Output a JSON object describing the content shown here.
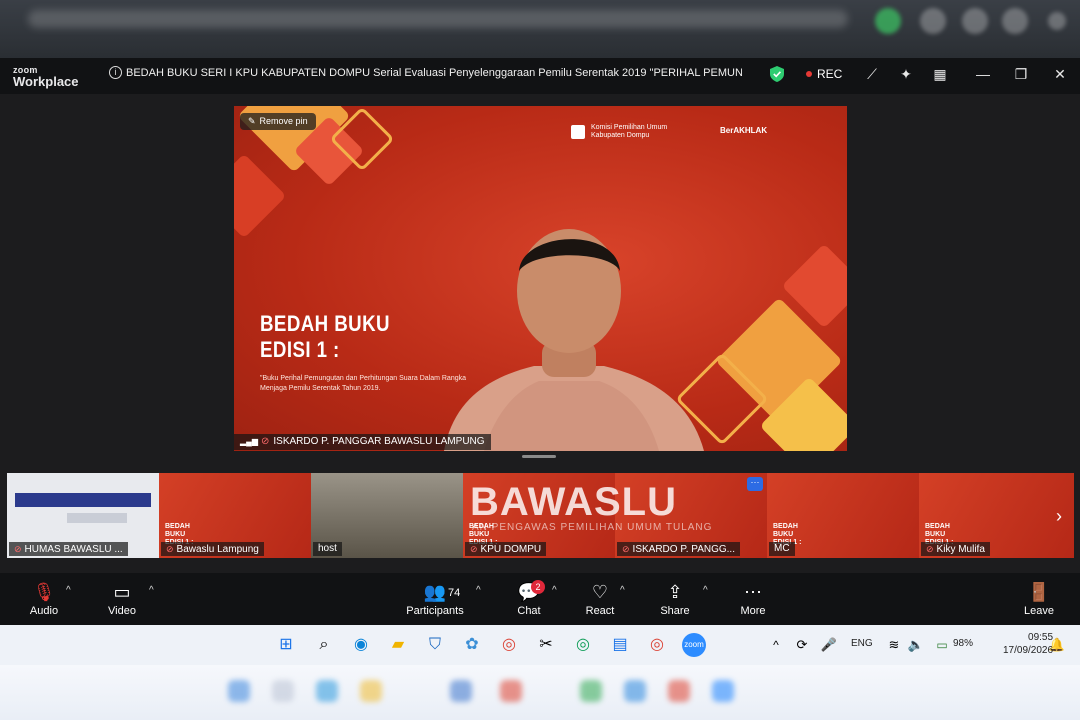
{
  "title_bar": {
    "brand_top": "zoom",
    "brand_bottom": "Workplace",
    "meeting_title": "BEDAH BUKU SERI I KPU KABUPATEN DOMPU Serial Evaluasi Penyelenggaraan Pemilu Serentak 2019 \"PERIHAL PEMUNGUTAN DAN PENGI",
    "rec_label": "REC"
  },
  "pinned": {
    "remove_pin_label": "Remove pin",
    "speaker_name": "ISKARDO P. PANGGAR BAWASLU LAMPUNG",
    "slide_title_line1": "BEDAH BUKU",
    "slide_title_line2": "EDISI 1 :",
    "slide_subtitle": "\"Buku Perihal Pemungutan dan Perhitungan Suara Dalam Rangka Menjaga Pemilu Serentak Tahun 2019.",
    "kpu_logo_text": "Komisi Pemilihan Umum Kabupaten Dompu",
    "berakhlak_text": "BerAKHLAK"
  },
  "gallery": {
    "tiles": [
      {
        "name": "HUMAS BAWASLU ..."
      },
      {
        "name": "Bawaslu Lampung"
      },
      {
        "name": "host"
      },
      {
        "name": "KPU DOMPU"
      },
      {
        "name": "ISKARDO P. PANGG..."
      },
      {
        "name": "MC"
      },
      {
        "name": "Kiky Mulifa"
      }
    ],
    "tile_slide_text": "BEDAH BUKU EDISI 1 :",
    "watermark": "BAWASLU",
    "watermark_sub": "AN PENGAWAS PEMILIHAN UMUM TULANG"
  },
  "toolbar": {
    "audio_label": "Audio",
    "video_label": "Video",
    "participants_label": "Participants",
    "participants_count": "74",
    "chat_label": "Chat",
    "chat_badge": "2",
    "react_label": "React",
    "share_label": "Share",
    "more_label": "More",
    "leave_label": "Leave"
  },
  "taskbar": {
    "language": "ENG",
    "battery": "98%",
    "time": "09:55",
    "date": "17/09/2026"
  },
  "colors": {
    "accent_red": "#c8331e",
    "rec_red": "#e53935",
    "shield_green": "#2ecc71",
    "chat_badge": "#e0283a"
  }
}
